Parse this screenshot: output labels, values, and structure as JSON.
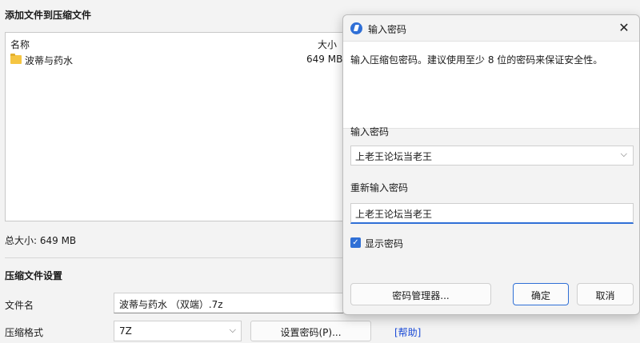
{
  "main": {
    "title": "添加文件到压缩文件",
    "list": {
      "col_name": "名称",
      "col_size": "大小",
      "rows": [
        {
          "name": "波蒂与药水",
          "size": "649 MB",
          "icon": "folder-icon"
        }
      ]
    },
    "total_size": "总大小: 649 MB",
    "settings_title": "压缩文件设置",
    "filename_label": "文件名",
    "filename_value": "波蒂与药水 （双端）.7z",
    "format_label": "压缩格式",
    "format_value": "7Z",
    "set_password_button": "设置密码(P)...",
    "help_link": "[帮助]"
  },
  "dialog": {
    "title": "输入密码",
    "description": "输入压缩包密码。建议使用至少 8 位的密码来保证安全性。",
    "password_label": "输入密码",
    "password_value": "上老王论坛当老王",
    "reenter_label": "重新输入密码",
    "reenter_value": "上老王论坛当老王",
    "show_password_label": "显示密码",
    "show_password_checked": true,
    "manager_button": "密码管理器...",
    "ok_button": "确定",
    "cancel_button": "取消",
    "accent_color": "#2f6fd6"
  }
}
